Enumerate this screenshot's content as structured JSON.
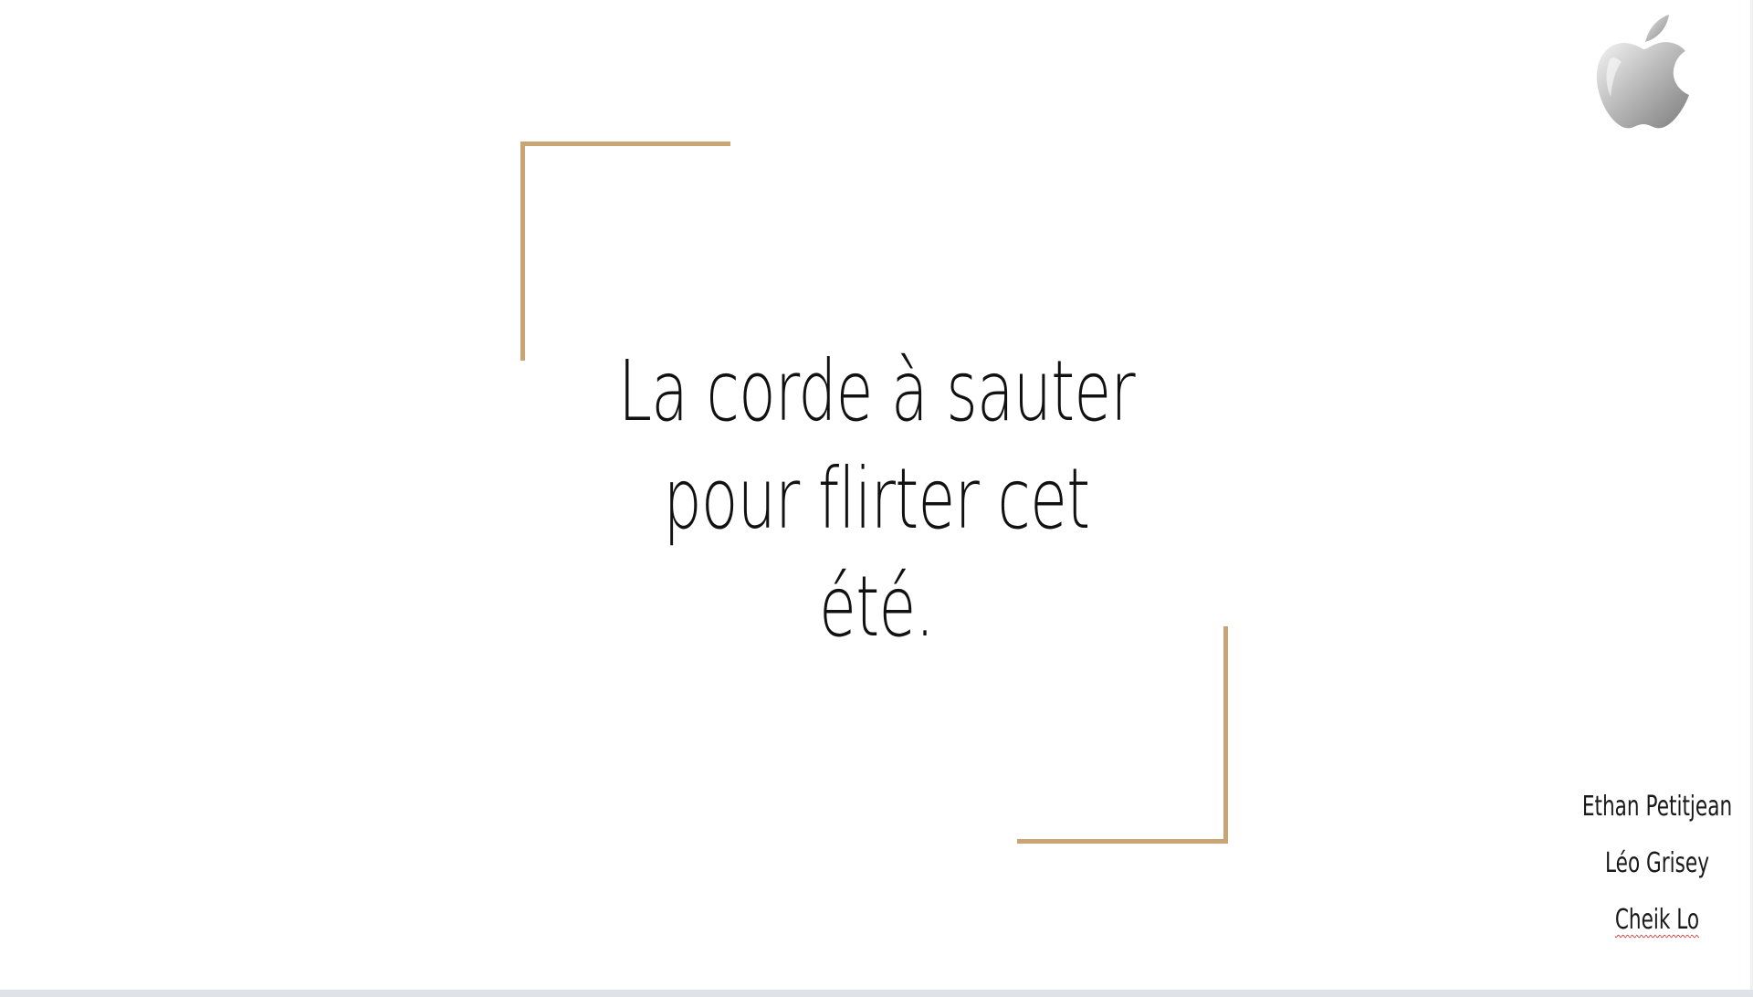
{
  "slide": {
    "title_lines": [
      "La corde à sauter",
      "pour flirter cet été."
    ],
    "authors": [
      "Ethan Petitjean",
      "Léo Grisey",
      "Cheik Lo"
    ],
    "logo_icon": "apple-logo-icon"
  },
  "colors": {
    "accent_gold": "#c9a574",
    "text": "#111111",
    "background": "#ffffff",
    "spellcheck_underline": "#d23a3a"
  }
}
